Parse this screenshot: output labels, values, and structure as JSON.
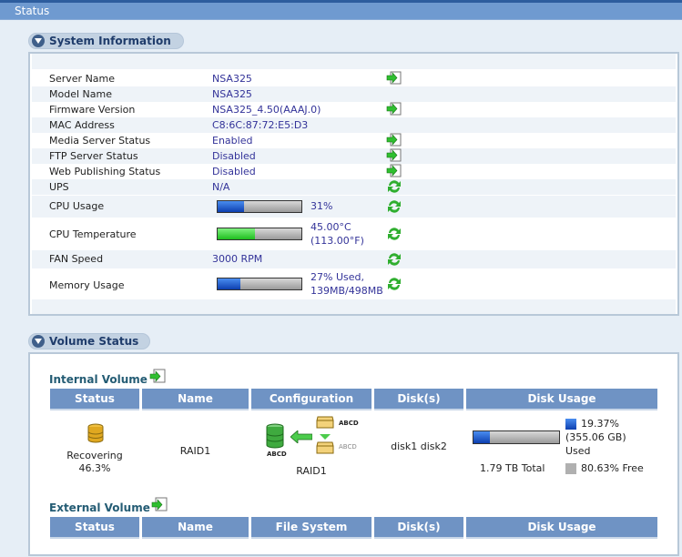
{
  "header": {
    "title": "Status"
  },
  "system": {
    "section_title": "System Information",
    "rows": [
      {
        "label": "Server Name",
        "value": "NSA325",
        "icon": "go"
      },
      {
        "label": "Model Name",
        "value": "NSA325",
        "icon": ""
      },
      {
        "label": "Firmware Version",
        "value": "NSA325_4.50(AAAJ.0)",
        "icon": "go"
      },
      {
        "label": "MAC Address",
        "value": "C8:6C:87:72:E5:D3",
        "icon": ""
      },
      {
        "label": "Media Server Status",
        "value": "Enabled",
        "icon": "go"
      },
      {
        "label": "FTP Server Status",
        "value": "Disabled",
        "icon": "go"
      },
      {
        "label": "Web Publishing Status",
        "value": "Disabled",
        "icon": "go"
      },
      {
        "label": "UPS",
        "value": "N/A",
        "icon": "refresh"
      }
    ],
    "cpu_usage": {
      "label": "CPU Usage",
      "value": "31%",
      "percent": 31
    },
    "cpu_temp": {
      "label": "CPU Temperature",
      "value_c": "45.00°C",
      "value_f": "(113.00°F)",
      "percent": 45
    },
    "fan": {
      "label": "FAN Speed",
      "value": "3000 RPM"
    },
    "memory": {
      "label": "Memory Usage",
      "line1": "27% Used,",
      "line2": "139MB/498MB",
      "percent": 27
    }
  },
  "volume": {
    "section_title": "Volume Status",
    "internal_title": "Internal Volume",
    "internal_headers": [
      "Status",
      "Name",
      "Configuration",
      "Disk(s)",
      "Disk Usage"
    ],
    "internal_row": {
      "status": "Recovering",
      "status_percent": "46.3%",
      "name": "RAID1",
      "config": "RAID1",
      "config_tag1": "ABCD",
      "config_tag2": "ABCD",
      "config_tag3": "ABCD",
      "disks": "disk1 disk2",
      "used_percent": "19.37%",
      "used_size": "(355.06 GB)",
      "used_label": "Used",
      "total": "1.79 TB Total",
      "free": "80.63% Free",
      "usage_fraction": 19.37
    },
    "external_title": "External Volume",
    "external_headers": [
      "Status",
      "Name",
      "File System",
      "Disk(s)",
      "Disk Usage"
    ]
  },
  "colors": {
    "accent": "#6f93c4",
    "link_text": "#333399",
    "used": "#1f6fe0",
    "free": "#b0b0b0"
  }
}
